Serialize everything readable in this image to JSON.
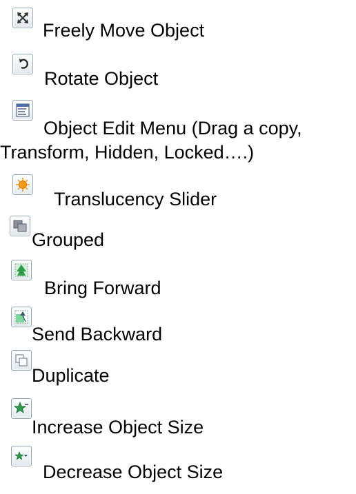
{
  "items": [
    {
      "icon": "move-arrows-icon",
      "label": "Freely Move Object"
    },
    {
      "icon": "rotate-icon",
      "label": "Rotate Object"
    },
    {
      "icon": "edit-menu-icon",
      "label": "Object Edit Menu (Drag a copy,",
      "label_line2": "Transform, Hidden, Locked….)"
    },
    {
      "icon": "translucency-sun-icon",
      "label": "Translucency Slider"
    },
    {
      "icon": "grouped-icon",
      "label": "Grouped"
    },
    {
      "icon": "bring-forward-icon",
      "label": "Bring Forward"
    },
    {
      "icon": "send-backward-icon",
      "label": "Send Backward"
    },
    {
      "icon": "duplicate-icon",
      "label": "Duplicate"
    },
    {
      "icon": "increase-size-star-icon",
      "label": "Increase Object Size"
    },
    {
      "icon": "decrease-size-star-icon",
      "label": "Decrease Object Size"
    }
  ],
  "colors": {
    "text": "#000000",
    "background": "#ffffff",
    "icon_border": "#9aa7b5",
    "accent_green": "#2e9a4a",
    "accent_orange": "#f39a18"
  }
}
